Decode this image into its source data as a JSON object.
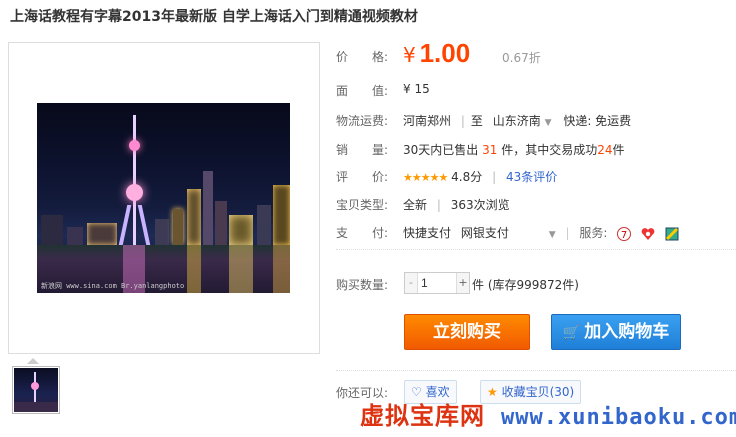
{
  "product": {
    "title": "上海话教程有字幕2013年最新版 自学上海话入门到精通视频教材"
  },
  "gallery": {
    "photo_watermark": "新浪网 www.sina.com   Br.yanlangphoto"
  },
  "props": {
    "price_label": "价　　格:",
    "currency": "¥",
    "price": "1.00",
    "discount": "0.67折",
    "face_value_label": "面　　值:",
    "face_value": "¥ 15",
    "shipping_label": "物流运费:",
    "ship_from": "河南郑州",
    "ship_to_sep": "至",
    "ship_to": "山东济南",
    "ship_fee": "快递: 免运费",
    "sales_label": "销　　量:",
    "sales_prefix": "30天内已售出",
    "sales_count": "31",
    "sales_mid": "件，其中交易成功",
    "sales_success": "24",
    "sales_suffix": "件",
    "rating_label": "评　　价:",
    "rating_stars": "★★★★★",
    "rating_score": "4.8分",
    "rating_count": "43条评价",
    "type_label": "宝贝类型:",
    "type_value": "全新",
    "views": "363次浏览",
    "pay_label": "支　　付:",
    "pay_quick": "快捷支付",
    "pay_bank": "网银支付",
    "service_label": "服务:",
    "qty_label": "购买数量:",
    "qty_minus": "-",
    "qty_value": "1",
    "qty_plus": "+",
    "qty_stock": "件 (库存999872件)"
  },
  "actions": {
    "buy_now": "立刻购买",
    "add_cart": "加入购物车"
  },
  "extra": {
    "also_label": "你还可以:",
    "like": "喜欢",
    "favorite": "收藏宝贝(30)"
  },
  "site_watermark": {
    "name": "虚拟宝库网",
    "url": "www.xunibaoku.com"
  },
  "colors": {
    "price": "#ff4400",
    "buy_button": "#f15a00",
    "cart_button": "#1f7fd8"
  }
}
